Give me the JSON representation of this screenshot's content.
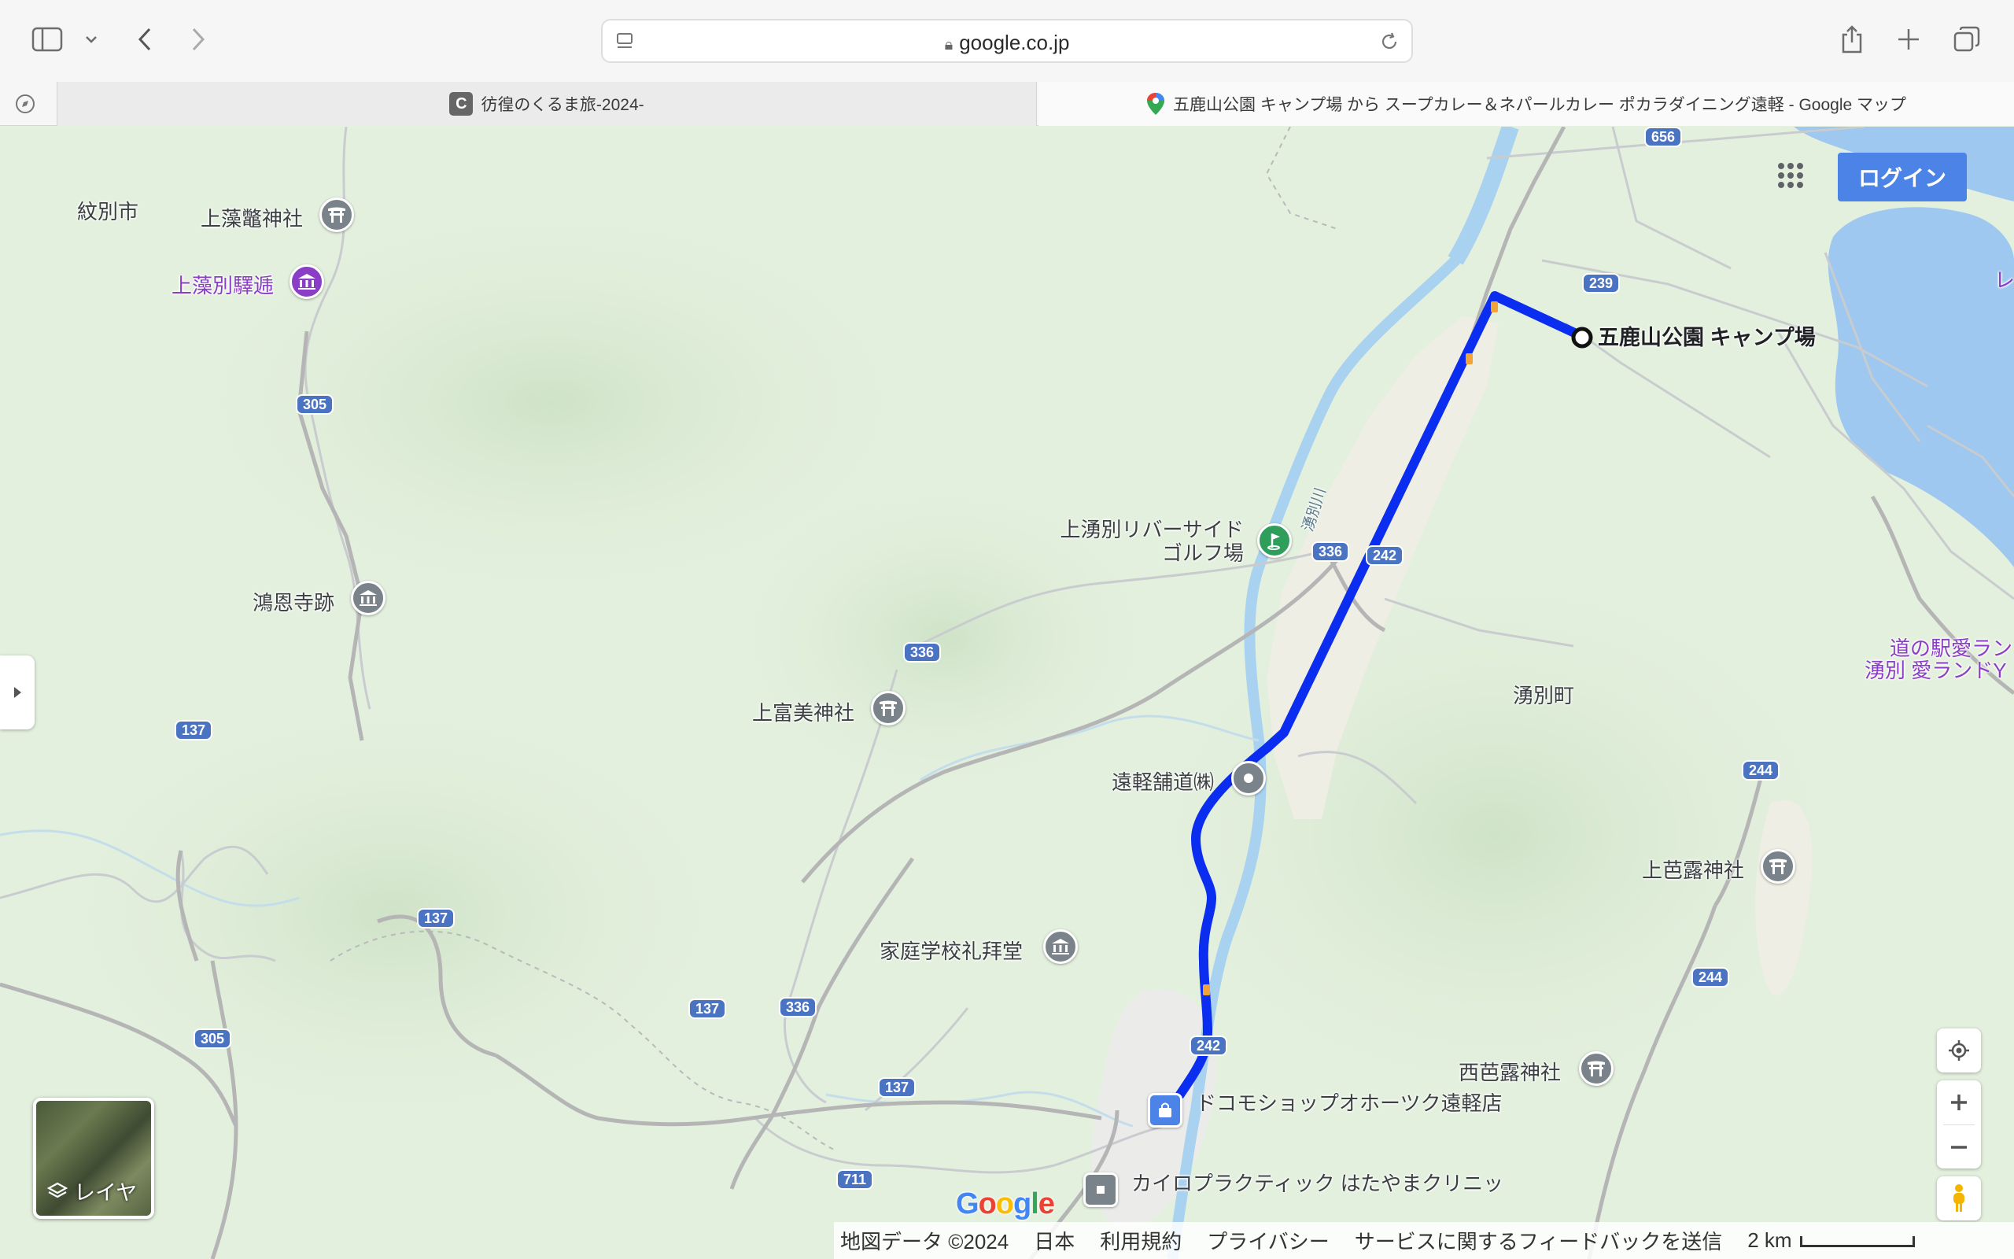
{
  "browser": {
    "url": "google.co.jp",
    "tabs": [
      {
        "label": "彷徨のくるま旅-2024-",
        "icon_letter": "C"
      },
      {
        "label": "五鹿山公園 キャンプ場 から スープカレー＆ネパールカレー ポカラダイニング遠軽 - Google マップ"
      }
    ]
  },
  "map": {
    "login_label": "ログイン",
    "layers_label": "レイヤ",
    "google_logo": "Google",
    "route_color": "#0b2df0",
    "places": {
      "destination": "五鹿山公園 キャンプ場",
      "monbetsu_city": "紋別市",
      "kamishokotsu_shrine": "上藻鼈神社",
      "kamishokotsu_station": "上藻別驛逓",
      "koonji_ruins": "鴻恩寺跡",
      "kamitomi_shrine": "上富美神社",
      "golf_line1": "上湧別リバーサイド",
      "golf_line2": "ゴルフ場",
      "engaru_paving": "遠軽舗道㈱",
      "yubetsu_town": "湧別町",
      "kamibaro_shrine": "上芭露神社",
      "nishibaro_shrine": "西芭露神社",
      "katei_gakko": "家庭学校礼拜堂",
      "docomo": "ドコモショップオホーツク遠軽店",
      "chiro": "カイロプラクティック はたやまクリニッ",
      "michinoeki_1": "道の駅愛ラン",
      "michinoeki_2": "湧別 愛ランドY",
      "edge_label": "レ",
      "river": "湧別川"
    },
    "roads": [
      "656",
      "239",
      "305",
      "336",
      "242",
      "137",
      "244",
      "711"
    ],
    "footer": {
      "copyright": "地図データ ©2024",
      "country": "日本",
      "terms": "利用規約",
      "privacy": "プライバシー",
      "feedback": "サービスに関するフィードバックを送信",
      "scale": "2 km"
    }
  }
}
